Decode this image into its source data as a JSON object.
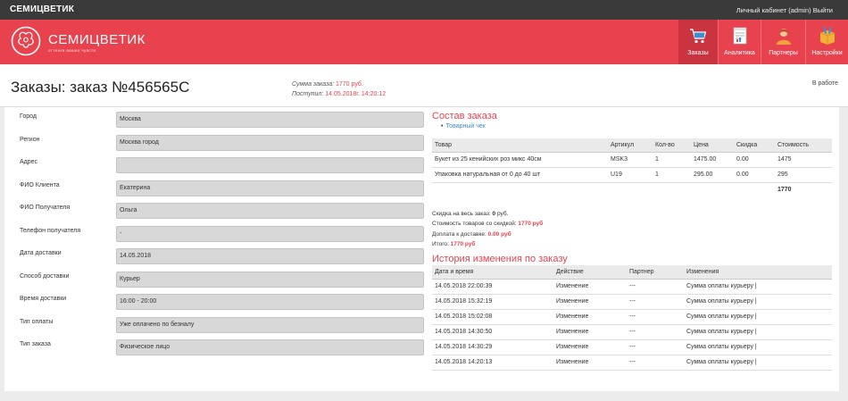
{
  "topbar": {
    "brand": "СЕМИЦВЕТИК",
    "account": "Личный кабинет (admin)",
    "logout": "Выйти"
  },
  "header": {
    "logo_name": "СЕМИЦВЕТИК",
    "logo_sub": "оттенки ваших чувств"
  },
  "nav": [
    {
      "label": "Заказы",
      "icon": "cart-icon",
      "active": true
    },
    {
      "label": "Аналитика",
      "icon": "analytics-icon"
    },
    {
      "label": "Партнеры",
      "icon": "partner-icon"
    },
    {
      "label": "Настройки",
      "icon": "settings-icon"
    }
  ],
  "page": {
    "title": "Заказы: заказ №456565C",
    "sum_label": "Сумма заказа:",
    "sum_value": "1770 руб.",
    "received_label": "Поступил:",
    "received_value": "14.05.2018г. 14:20:12",
    "status": "В работе"
  },
  "form": [
    {
      "label": "Город",
      "value": "Москва"
    },
    {
      "label": "Регион",
      "value": "Москва город"
    },
    {
      "label": "Адрес",
      "value": ""
    },
    {
      "label": "ФИО Клиента",
      "value": "Екатерина"
    },
    {
      "label": "ФИО Получателя",
      "value": "Ольга"
    },
    {
      "label": "Телефон получателя",
      "value": "-"
    },
    {
      "label": "Дата доставки",
      "value": "14.05.2018"
    },
    {
      "label": "Способ доставки",
      "value": "Курьер"
    },
    {
      "label": "Время доставки",
      "value": "16:00 - 20:00"
    },
    {
      "label": "Тип оплаты",
      "value": "Уже оплачено по безналу"
    },
    {
      "label": "Тип заказа",
      "value": "Физическое лицо"
    }
  ],
  "order": {
    "title": "Состав заказа",
    "receipt_link": "Товарный чек",
    "headers": [
      "Товар",
      "Артикул",
      "Кол-во",
      "Цена",
      "Скидка",
      "Стоимость"
    ],
    "rows": [
      [
        "Букет из 25 кенийских роз микс 40см",
        "MSK3",
        "1",
        "1475.00",
        "0.00",
        "1475"
      ],
      [
        "Упаковка натуральная от 0 до 40 шт",
        "U19",
        "1",
        "295.00",
        "0.00",
        "295"
      ]
    ],
    "total": "1770",
    "discount_label": "Скидка на весь заказ:",
    "discount_value": "0",
    "discount_unit": "руб.",
    "discounted_label": "Стоимость товаров со скидкой:",
    "discounted_value": "1770 руб",
    "delivery_label": "Доплата к доставке:",
    "delivery_value": "0.00 руб",
    "grand_label": "Итого:",
    "grand_value": "1770 руб"
  },
  "history": {
    "title": "История изменения по заказу",
    "headers": [
      "Дата и время",
      "Действие",
      "Партнер",
      "Изменения"
    ],
    "rows": [
      [
        "14.05.2018 22:00:39",
        "Изменение",
        "---",
        "Сумма оплаты курьеру |"
      ],
      [
        "14.05.2018 15:32:19",
        "Изменение",
        "---",
        "Сумма оплаты курьеру |"
      ],
      [
        "14.05.2018 15:02:08",
        "Изменение",
        "---",
        "Сумма оплаты курьеру |"
      ],
      [
        "14.05.2018 14:30:50",
        "Изменение",
        "---",
        "Сумма оплаты курьеру |"
      ],
      [
        "14.05.2018 14:30:29",
        "Изменение",
        "---",
        "Сумма оплаты курьеру |"
      ],
      [
        "14.05.2018 14:20:13",
        "Изменение",
        "---",
        "Сумма оплаты курьеру |"
      ]
    ]
  },
  "colors": {
    "accent": "#e8424f",
    "topbar": "#3a3a3a",
    "link": "#3b8bd8"
  }
}
